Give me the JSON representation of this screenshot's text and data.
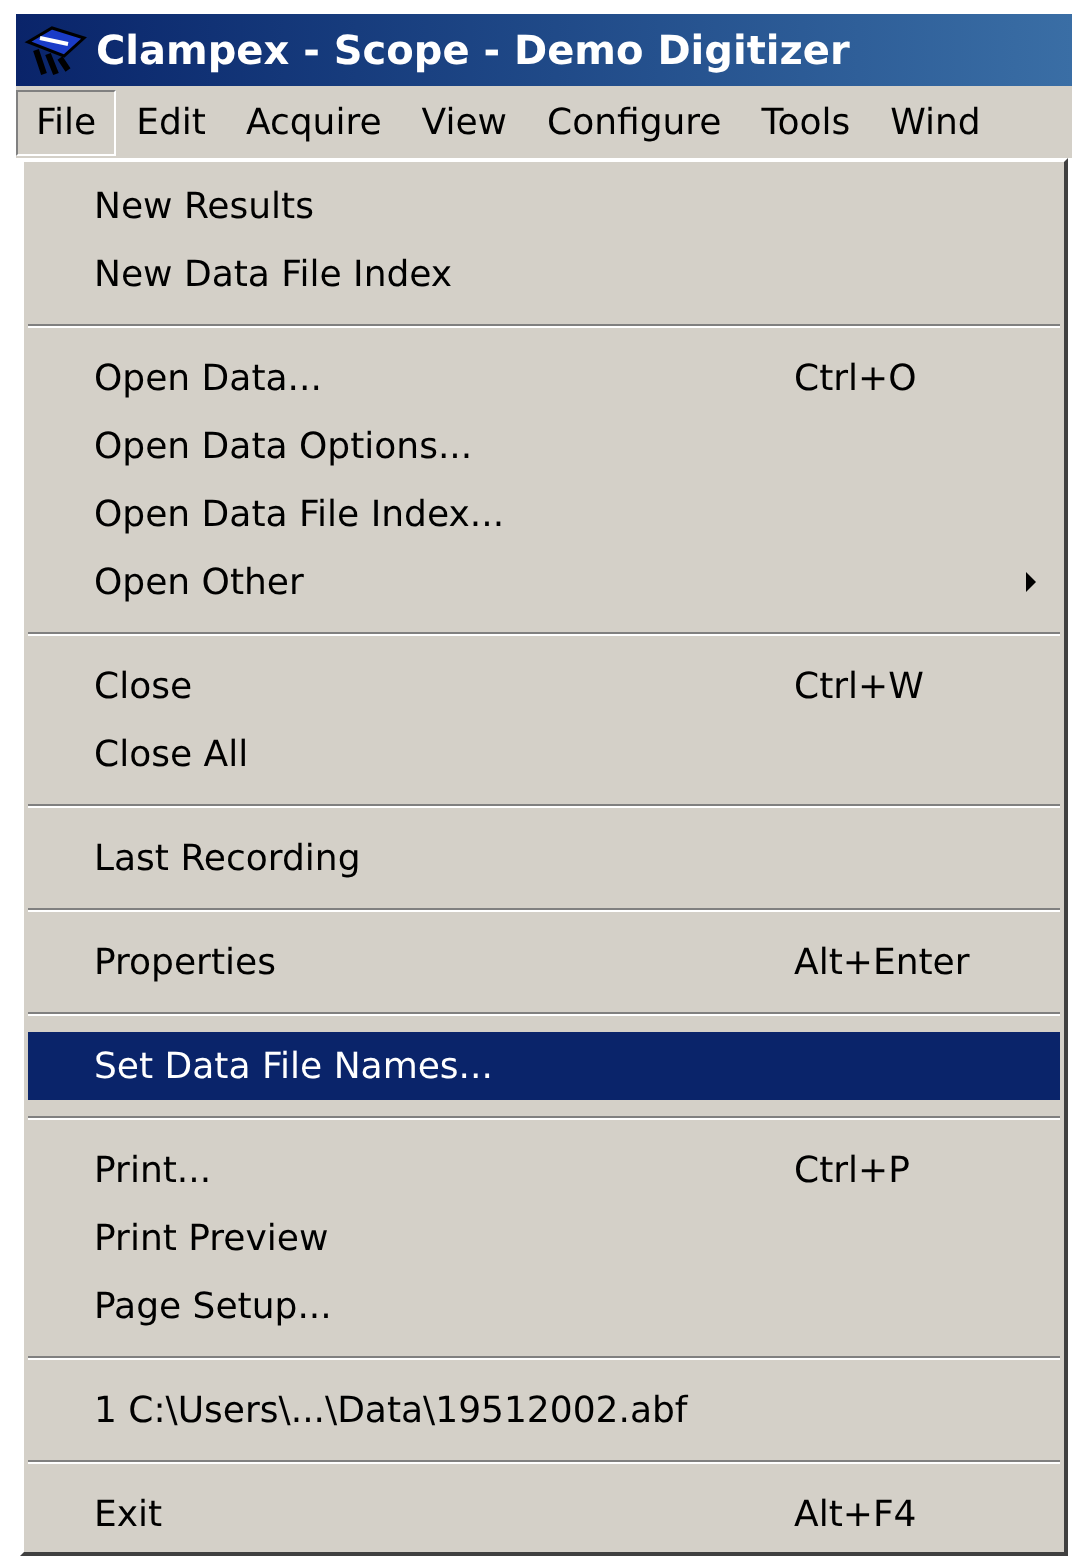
{
  "window": {
    "title": "Clampex - Scope - Demo Digitizer"
  },
  "menu_bar": [
    {
      "label": "File",
      "selected": true
    },
    {
      "label": "Edit",
      "selected": false
    },
    {
      "label": "Acquire",
      "selected": false
    },
    {
      "label": "View",
      "selected": false
    },
    {
      "label": "Configure",
      "selected": false
    },
    {
      "label": "Tools",
      "selected": false
    },
    {
      "label": "Wind",
      "selected": false
    }
  ],
  "file_menu": [
    {
      "kind": "item",
      "label": "New Results",
      "selected": false
    },
    {
      "kind": "item",
      "label": "New Data File Index",
      "selected": false
    },
    {
      "kind": "separator"
    },
    {
      "kind": "item",
      "label": "Open Data...",
      "shortcut": "Ctrl+O",
      "selected": false
    },
    {
      "kind": "item",
      "label": "Open Data Options...",
      "selected": false
    },
    {
      "kind": "item",
      "label": "Open Data File Index...",
      "selected": false
    },
    {
      "kind": "submenu",
      "label": "Open Other",
      "selected": false
    },
    {
      "kind": "separator"
    },
    {
      "kind": "item",
      "label": "Close",
      "shortcut": "Ctrl+W",
      "selected": false
    },
    {
      "kind": "item",
      "label": "Close All",
      "selected": false
    },
    {
      "kind": "separator"
    },
    {
      "kind": "item",
      "label": "Last Recording",
      "selected": false
    },
    {
      "kind": "separator"
    },
    {
      "kind": "item",
      "label": "Properties",
      "shortcut": "Alt+Enter",
      "selected": false
    },
    {
      "kind": "separator"
    },
    {
      "kind": "item",
      "label": "Set Data File Names...",
      "selected": true
    },
    {
      "kind": "separator"
    },
    {
      "kind": "item",
      "label": "Print...",
      "shortcut": "Ctrl+P",
      "selected": false
    },
    {
      "kind": "item",
      "label": "Print Preview",
      "selected": false
    },
    {
      "kind": "item",
      "label": "Page Setup...",
      "selected": false
    },
    {
      "kind": "separator"
    },
    {
      "kind": "item",
      "label": "1 C:\\Users\\...\\Data\\19512002.abf",
      "selected": false
    },
    {
      "kind": "separator"
    },
    {
      "kind": "item",
      "label": "Exit",
      "shortcut": "Alt+F4",
      "selected": false
    }
  ]
}
